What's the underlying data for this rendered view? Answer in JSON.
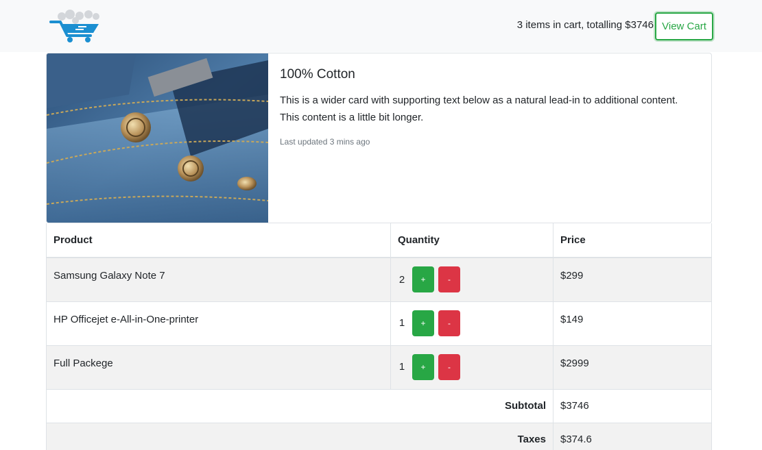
{
  "header": {
    "cart_summary": "3 items in cart, totalling $3746",
    "view_cart_label": "View Cart"
  },
  "card": {
    "title": "100% Cotton",
    "text": "This is a wider card with supporting text below as a natural lead-in to additional content. This content is a little bit longer.",
    "updated": "Last updated 3 mins ago"
  },
  "table": {
    "headers": {
      "product": "Product",
      "quantity": "Quantity",
      "price": "Price"
    },
    "rows": [
      {
        "product": "Samsung Galaxy Note 7",
        "quantity": "2",
        "price": "$299",
        "plus": "+",
        "minus": "-"
      },
      {
        "product": "HP Officejet e-All-in-One-printer",
        "quantity": "1",
        "price": "$149",
        "plus": "+",
        "minus": "-"
      },
      {
        "product": "Full Packege",
        "quantity": "1",
        "price": "$2999",
        "plus": "+",
        "minus": "-"
      }
    ],
    "subtotal_label": "Subtotal",
    "subtotal_value": "$3746",
    "taxes_label": "Taxes",
    "taxes_value": "$374.6"
  },
  "colors": {
    "navbar_bg": "#f8f9fa",
    "success": "#28a745",
    "danger": "#dc3545",
    "stripe": "#f2f2f2"
  },
  "icons": {
    "logo": "shopping-cart-logo-icon",
    "card_image": "denim-jeans-pocket-photo"
  }
}
